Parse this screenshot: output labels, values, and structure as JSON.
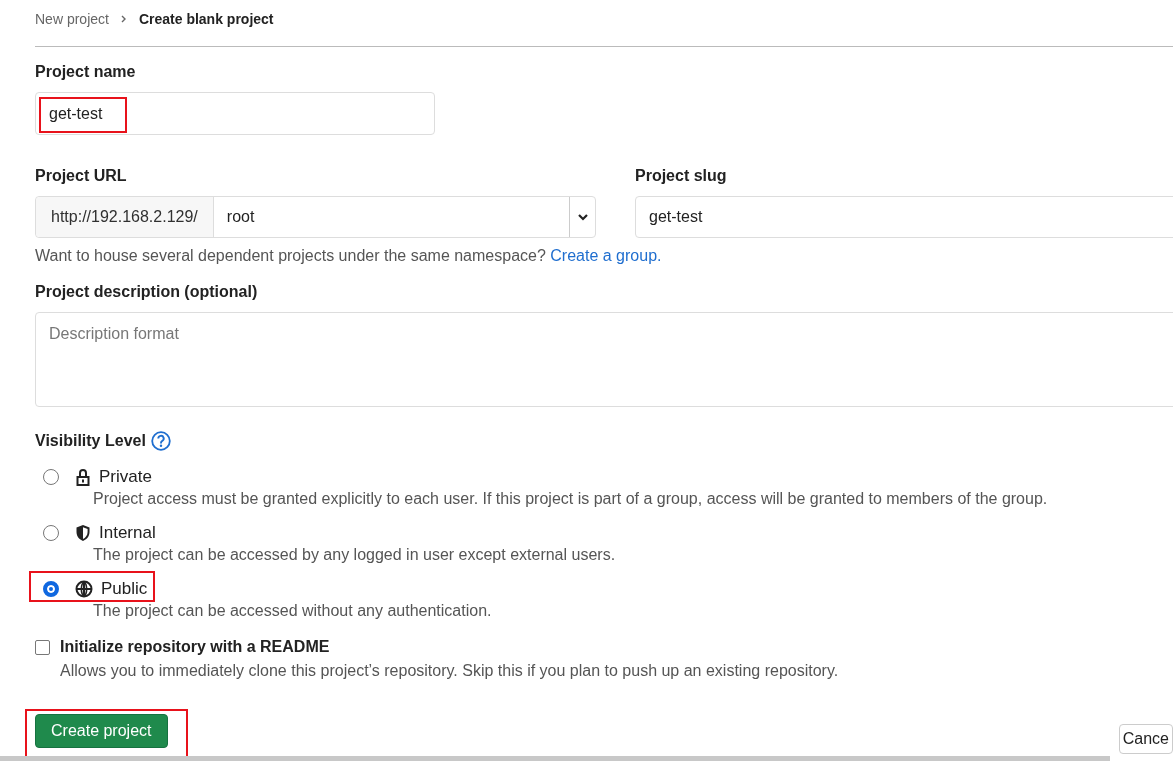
{
  "breadcrumb": [
    {
      "label": "New project",
      "current": false
    },
    {
      "label": "Create blank project",
      "current": true
    }
  ],
  "project_name": {
    "label": "Project name",
    "value": "get-test",
    "highlighted": true
  },
  "project_url": {
    "label": "Project URL",
    "prefix": "http://192.168.2.129/",
    "namespace": "root"
  },
  "project_slug": {
    "label": "Project slug",
    "value": "get-test"
  },
  "namespace_help": {
    "text": "Want to house several dependent projects under the same namespace?",
    "link": "Create a group."
  },
  "description": {
    "label": "Project description (optional)",
    "placeholder": "Description format"
  },
  "visibility": {
    "label": "Visibility Level",
    "options": [
      {
        "kind": "private",
        "label": "Private",
        "description": "Project access must be granted explicitly to each user. If this project is part of a group, access will be granted to members of the group.",
        "selected": false,
        "highlighted": false
      },
      {
        "kind": "internal",
        "label": "Internal",
        "description": "The project can be accessed by any logged in user except external users.",
        "selected": false,
        "highlighted": false
      },
      {
        "kind": "public",
        "label": "Public",
        "description": "The project can be accessed without any authentication.",
        "selected": true,
        "highlighted": true
      }
    ]
  },
  "readme": {
    "label": "Initialize repository with a README",
    "description": "Allows you to immediately clone this project’s repository. Skip this if you plan to push up an existing repository.",
    "checked": false
  },
  "buttons": [
    {
      "kind": "primary",
      "label": "Create project",
      "highlighted": true
    },
    {
      "kind": "secondary",
      "label": "Cance",
      "highlighted": false
    }
  ]
}
